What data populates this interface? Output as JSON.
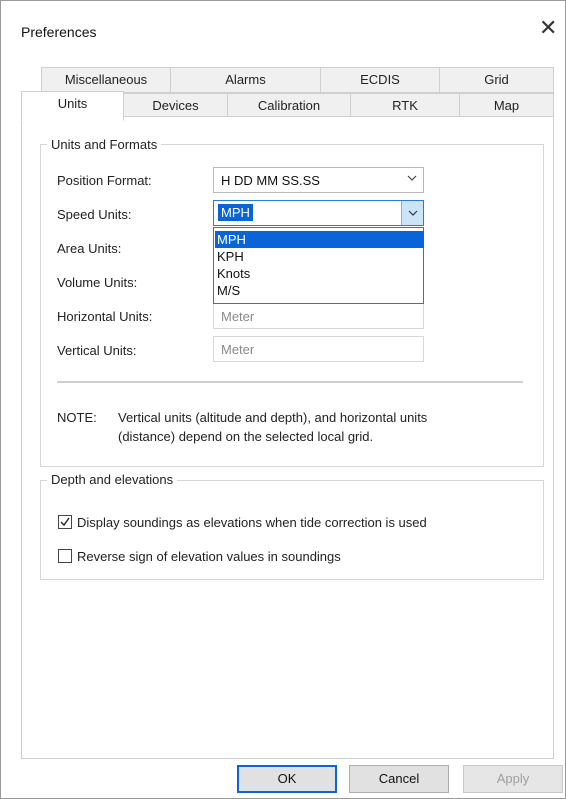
{
  "window": {
    "title": "Preferences",
    "close_glyph": "✕"
  },
  "tabs": {
    "row1": [
      "Miscellaneous",
      "Alarms",
      "ECDIS",
      "Grid"
    ],
    "row2": [
      "Units",
      "Devices",
      "Calibration",
      "RTK",
      "Map"
    ],
    "selected": "Units"
  },
  "units_group": {
    "title": "Units and Formats",
    "fields": [
      {
        "label": "Position Format:",
        "value": "H DD MM SS.SS",
        "state": "enabled"
      },
      {
        "label": "Speed Units:",
        "value": "MPH",
        "state": "open"
      },
      {
        "label": "Area Units:",
        "value": "",
        "state": "covered"
      },
      {
        "label": "Volume Units:",
        "value": "",
        "state": "covered"
      },
      {
        "label": "Horizontal Units:",
        "value": "Meter",
        "state": "disabled"
      },
      {
        "label": "Vertical Units:",
        "value": "Meter",
        "state": "disabled"
      }
    ],
    "speed_options": [
      "MPH",
      "KPH",
      "Knots",
      "M/S"
    ],
    "speed_selected_index": 0,
    "note_label": "NOTE:",
    "note_line1": "Vertical units (altitude and depth), and horizontal units",
    "note_line2": "(distance) depend on the selected local grid."
  },
  "depth_group": {
    "title": "Depth and elevations",
    "options": [
      {
        "label": "Display soundings as elevations when tide correction is used",
        "checked": true
      },
      {
        "label": "Reverse sign of elevation values in soundings",
        "checked": false
      }
    ]
  },
  "buttons": {
    "ok": "OK",
    "cancel": "Cancel",
    "apply": "Apply"
  },
  "colors": {
    "accent": "#0a64d8",
    "highlight_button": "#cce4f7"
  }
}
